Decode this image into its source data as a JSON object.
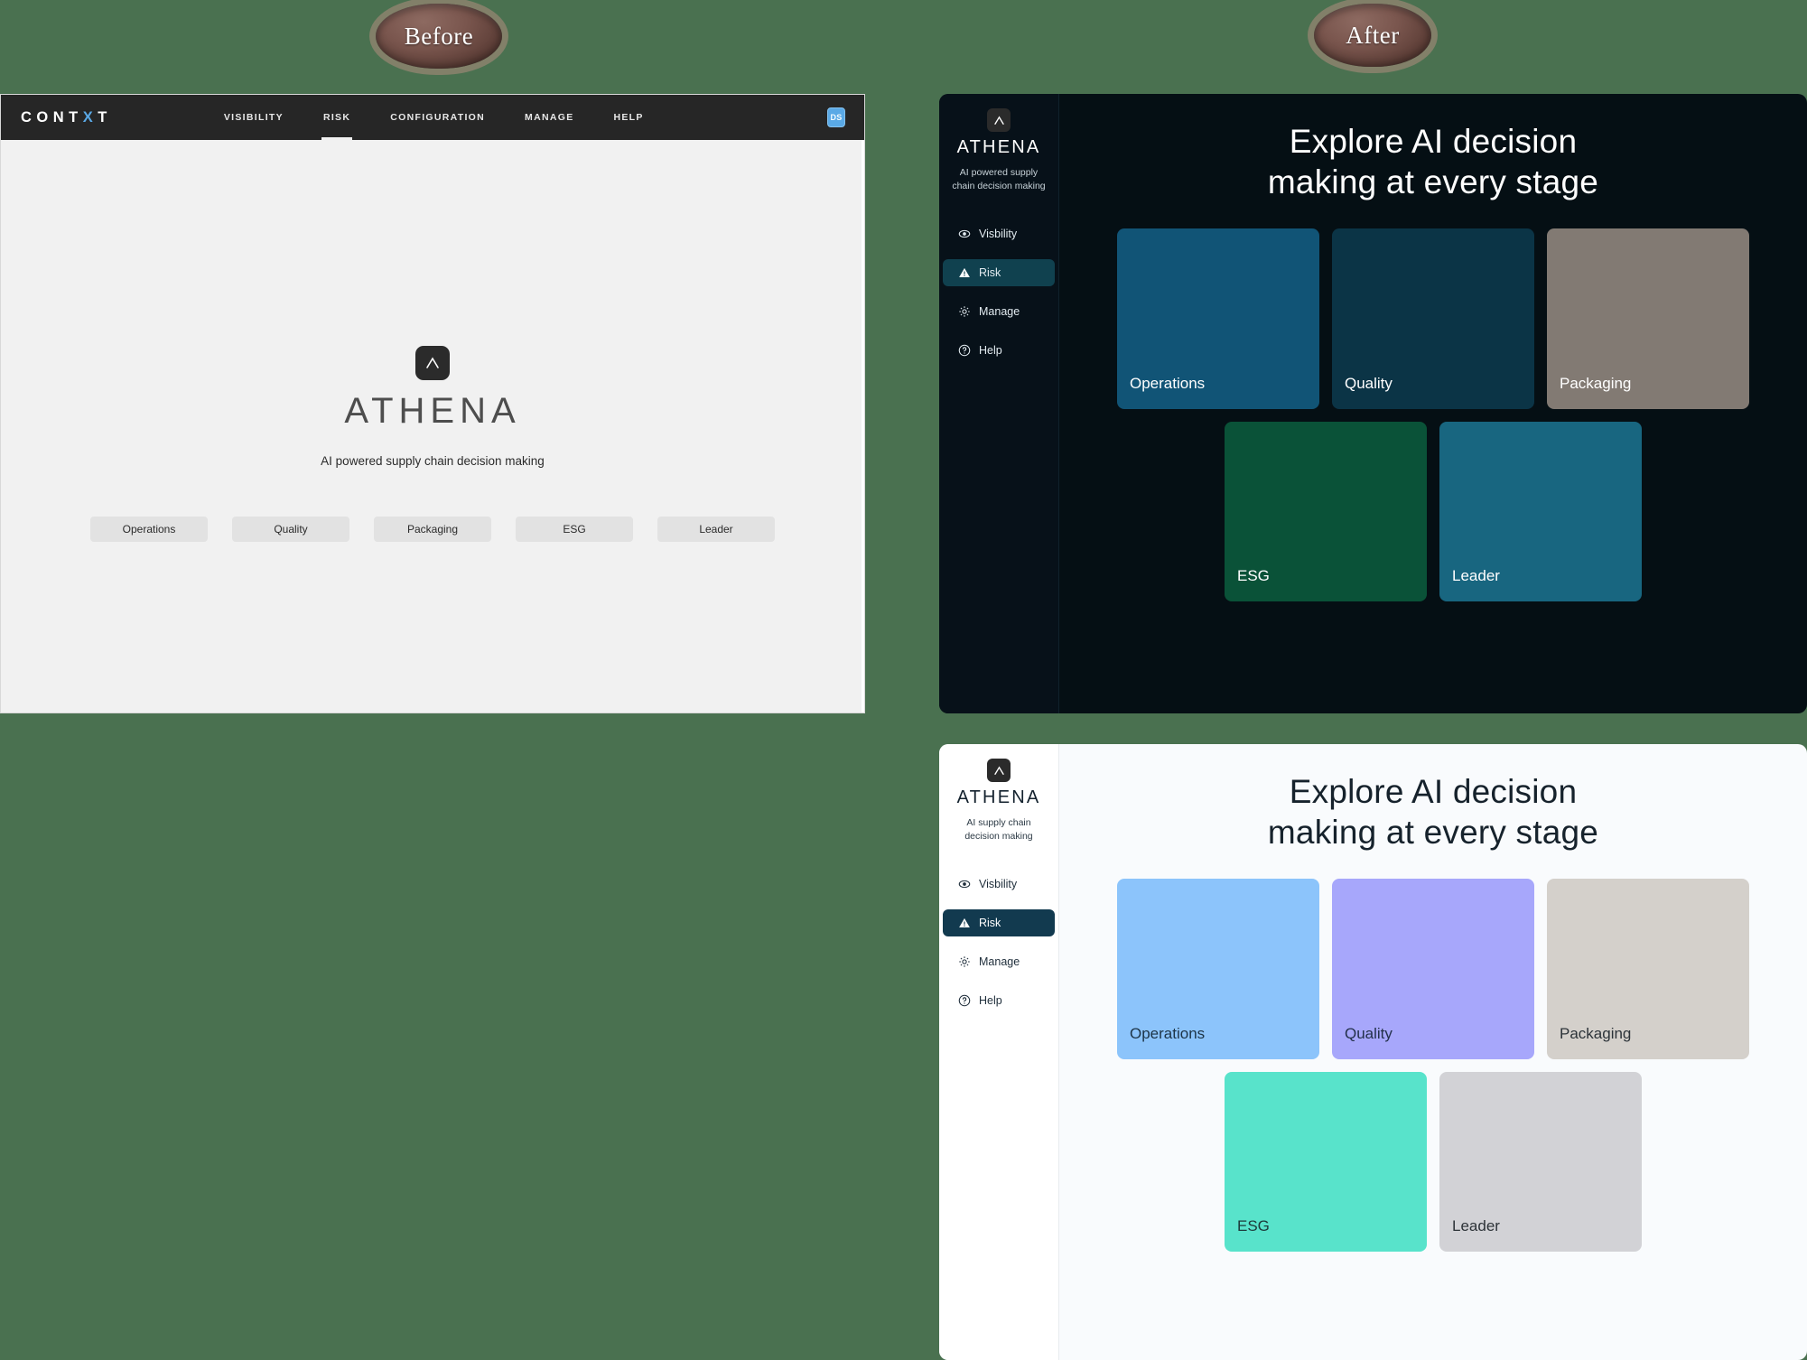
{
  "badges": {
    "before": "Before",
    "after": "After"
  },
  "before": {
    "brand": {
      "prefix": "CONT",
      "accent": "X",
      "suffix": "T"
    },
    "nav": [
      {
        "label": "VISIBILITY",
        "active": false
      },
      {
        "label": "RISK",
        "active": true
      },
      {
        "label": "CONFIGURATION",
        "active": false
      },
      {
        "label": "MANAGE",
        "active": false
      },
      {
        "label": "HELP",
        "active": false
      }
    ],
    "user_badge": "DS",
    "logo_word": "ATHENA",
    "tagline": "AI powered supply chain decision making",
    "chips": [
      "Operations",
      "Quality",
      "Packaging",
      "ESG",
      "Leader"
    ]
  },
  "after_dark": {
    "sidebar": {
      "logo_word": "ATHENA",
      "tagline": "AI powered supply chain decision making",
      "items": [
        {
          "label": "Visbility",
          "icon": "eye-icon",
          "active": false
        },
        {
          "label": "Risk",
          "icon": "warning-triangle-icon",
          "active": true
        },
        {
          "label": "Manage",
          "icon": "gear-icon",
          "active": false
        },
        {
          "label": "Help",
          "icon": "question-circle-icon",
          "active": false
        }
      ]
    },
    "title_line1": "Explore AI decision",
    "title_line2": "making at every stage",
    "cards_row1": [
      {
        "label": "Operations",
        "color": "#115476",
        "text_color": "#ffffff"
      },
      {
        "label": "Quality",
        "color": "#0b3446",
        "text_color": "#ffffff"
      },
      {
        "label": "Packaging",
        "color": "#827a73",
        "text_color": "#ffffff"
      }
    ],
    "cards_row2": [
      {
        "label": "ESG",
        "color": "#0a5238",
        "text_color": "#ffffff"
      },
      {
        "label": "Leader",
        "color": "#186680",
        "text_color": "#ffffff"
      }
    ]
  },
  "after_light": {
    "sidebar": {
      "logo_word": "ATHENA",
      "tagline": "AI supply chain decision making",
      "items": [
        {
          "label": "Visbility",
          "icon": "eye-icon",
          "active": false
        },
        {
          "label": "Risk",
          "icon": "warning-triangle-icon",
          "active": true
        },
        {
          "label": "Manage",
          "icon": "gear-icon",
          "active": false
        },
        {
          "label": "Help",
          "icon": "question-circle-icon",
          "active": false
        }
      ]
    },
    "title_line1": "Explore AI decision",
    "title_line2": "making at every stage",
    "cards_row1": [
      {
        "label": "Operations",
        "color": "#8cc4fb",
        "text_color": "#1d3446"
      },
      {
        "label": "Quality",
        "color": "#a7a7fb",
        "text_color": "#23304a"
      },
      {
        "label": "Packaging",
        "color": "#d4d0cb",
        "text_color": "#2c3339"
      }
    ],
    "cards_row2": [
      {
        "label": "ESG",
        "color": "#58e3cb",
        "text_color": "#1d3a3a"
      },
      {
        "label": "Leader",
        "color": "#d2d2d6",
        "text_color": "#2d3338"
      }
    ]
  },
  "colors": {
    "page_background": "#4a7150",
    "before_surface": "#f1f1f1",
    "before_topbar": "#262626",
    "dark_panel_bg": "#050f14",
    "dark_sidebar_bg": "#071119",
    "light_panel_bg": "#f9fbfd",
    "light_sidebar_bg": "#ffffff",
    "accent_blue": "#5aa9e6",
    "active_dark": "#10414f",
    "active_light": "#123a4f"
  }
}
